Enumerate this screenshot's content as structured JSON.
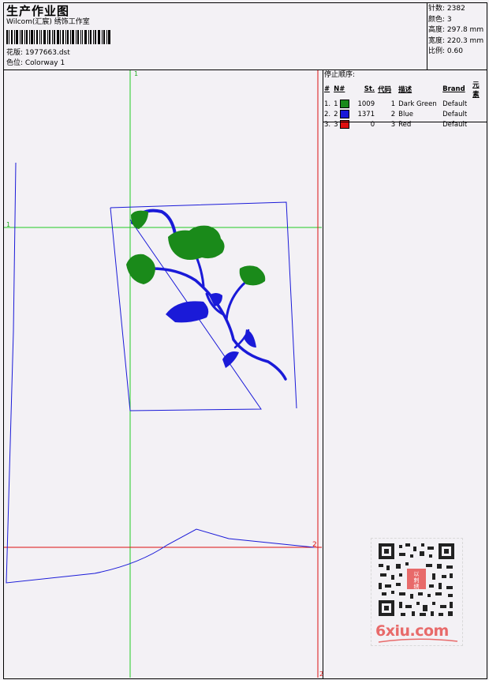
{
  "header": {
    "title": "生产作业图",
    "subtitle": "Wilcom(汇宸) 绣饰工作室",
    "design_label": "花版: 1977663.dst",
    "colorway_label": "色位: Colorway 1"
  },
  "stats": [
    {
      "label": "针数:",
      "value": "2382"
    },
    {
      "label": "颜色:",
      "value": "3"
    },
    {
      "label": "高度:",
      "value": "297.8 mm"
    },
    {
      "label": "宽度:",
      "value": "220.3 mm"
    },
    {
      "label": "比例:",
      "value": "0.60"
    }
  ],
  "stop_sequence": {
    "heading": "停止顺序:",
    "columns": [
      "#",
      "N#",
      "St.",
      "代码",
      "描述",
      "Brand",
      "元素"
    ],
    "rows": [
      {
        "index": "1.",
        "n": "1",
        "color": "#1a8a1a",
        "stitches": "1009",
        "code": "1",
        "desc": "Dark Green",
        "brand": "Default",
        "elements": ""
      },
      {
        "index": "2.",
        "n": "2",
        "color": "#1818d8",
        "stitches": "1371",
        "code": "2",
        "desc": "Blue",
        "brand": "Default",
        "elements": ""
      },
      {
        "index": "3.",
        "n": "3",
        "color": "#e01010",
        "stitches": "0",
        "code": "3",
        "desc": "Red",
        "brand": "Default",
        "elements": ""
      }
    ]
  },
  "canvas": {
    "marker_1_top": "1",
    "marker_1_left": "1",
    "marker_2_right": "2",
    "marker_2_bottom": "2",
    "guide_green": "#22cc22",
    "guide_red": "#dd1111",
    "stitch_blue": "#1a1ad8",
    "stitch_green": "#1a8a1a"
  },
  "watermark": {
    "qr_badge_lines": [
      "以",
      "刺",
      "绣"
    ],
    "site_text": "6xiu.com"
  }
}
